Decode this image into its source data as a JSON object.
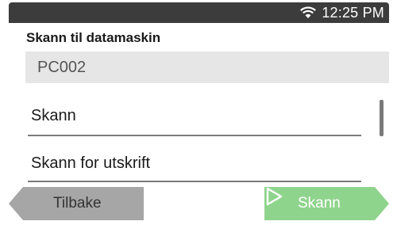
{
  "status_bar": {
    "time": "12:25 PM",
    "wifi_icon": "wifi-icon"
  },
  "screen": {
    "title": "Skann til datamaskin",
    "destination": "PC002",
    "items": [
      {
        "label": "Skann"
      },
      {
        "label": "Skann for utskrift"
      }
    ]
  },
  "buttons": {
    "back_label": "Tilbake",
    "scan_label": "Skann",
    "scan_icon": "play-arrow-icon"
  },
  "colors": {
    "status_bar": "#3c3c3c",
    "back_button": "#a6a6a6",
    "scan_button": "#8fd48c",
    "destination_bg": "#e6e6e6"
  }
}
